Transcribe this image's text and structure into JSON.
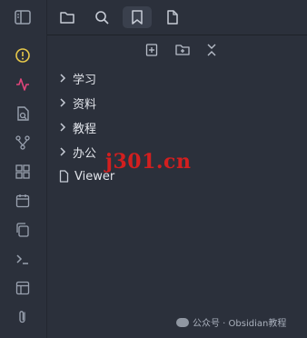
{
  "sidebar_tabs": [
    {
      "name": "files"
    },
    {
      "name": "search"
    },
    {
      "name": "bookmarks",
      "active": true
    },
    {
      "name": "page"
    }
  ],
  "ribbon": {
    "items": [
      "warning-circle",
      "graph-activity",
      "file-search",
      "git-branch",
      "grid",
      "calendar",
      "copy",
      "terminal",
      "layout",
      "paperclip"
    ]
  },
  "nav_actions": [
    "new-note",
    "new-folder",
    "collapse-all"
  ],
  "tree": {
    "items": [
      {
        "label": "学习",
        "type": "folder"
      },
      {
        "label": "资料",
        "type": "folder"
      },
      {
        "label": "教程",
        "type": "folder"
      },
      {
        "label": "办公",
        "type": "folder"
      },
      {
        "label": "Viewer",
        "type": "file"
      }
    ]
  },
  "watermark_text": "j301.cn",
  "footer": {
    "text": "公众号 · Obsidian教程"
  },
  "colors": {
    "background": "#2b303b",
    "warning": "#e6c84a",
    "activity": "#e0457b",
    "watermark": "#d21f1f"
  }
}
